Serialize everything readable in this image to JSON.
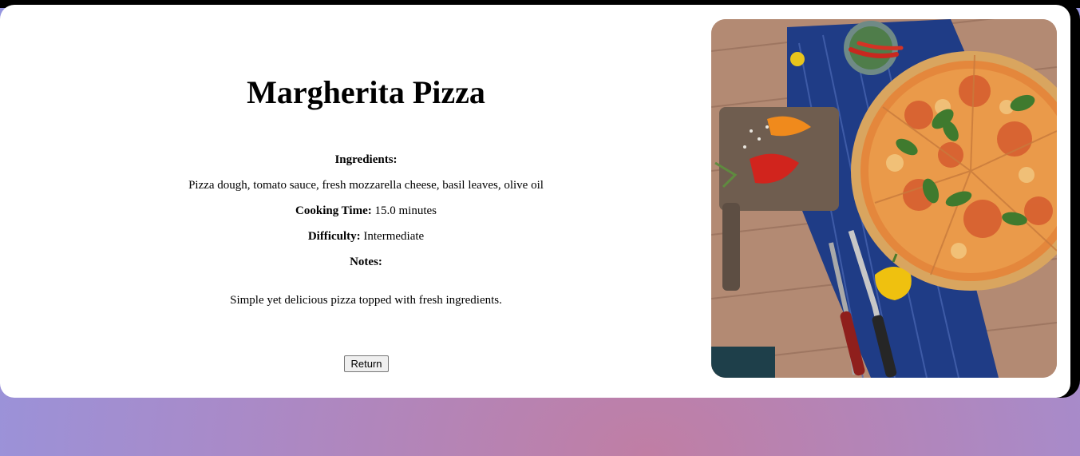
{
  "recipe": {
    "title": "Margherita Pizza",
    "ingredients_label": "Ingredients:",
    "ingredients": "Pizza dough, tomato sauce, fresh mozzarella cheese, basil leaves, olive oil",
    "cooking_time_label": "Cooking Time:",
    "cooking_time": "15.0 minutes",
    "difficulty_label": "Difficulty:",
    "difficulty": "Intermediate",
    "notes_label": "Notes:",
    "notes": "Simple yet delicious pizza topped with fresh ingredients."
  },
  "actions": {
    "return_label": "Return"
  },
  "image": {
    "subject": "pizza-photo"
  },
  "colors": {
    "page_background": "#a98ac8",
    "card_background": "#ffffff",
    "card_border": "#000000",
    "text": "#000000"
  }
}
